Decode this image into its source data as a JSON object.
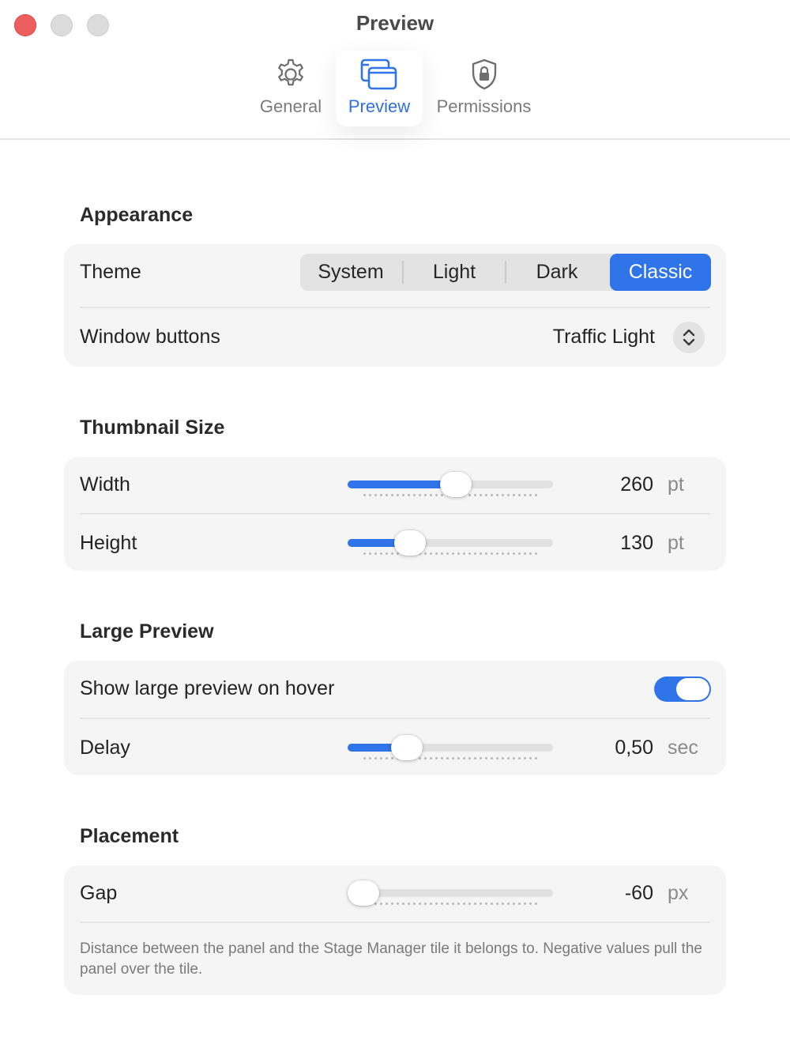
{
  "window": {
    "title": "Preview"
  },
  "tabs": [
    {
      "label": "General",
      "icon": "gear-icon",
      "selected": false
    },
    {
      "label": "Preview",
      "icon": "windows-icon",
      "selected": true
    },
    {
      "label": "Permissions",
      "icon": "shield-lock-icon",
      "selected": false
    }
  ],
  "appearance": {
    "title": "Appearance",
    "theme": {
      "label": "Theme",
      "options": [
        "System",
        "Light",
        "Dark",
        "Classic"
      ],
      "selected": "Classic"
    },
    "window_buttons": {
      "label": "Window buttons",
      "value": "Traffic Light"
    }
  },
  "thumbnail_size": {
    "title": "Thumbnail Size",
    "width": {
      "label": "Width",
      "value": "260",
      "unit": "pt",
      "fraction": 0.53
    },
    "height": {
      "label": "Height",
      "value": "130",
      "unit": "pt",
      "fraction": 0.27
    }
  },
  "large_preview": {
    "title": "Large Preview",
    "show_on_hover": {
      "label": "Show large preview on hover",
      "on": true
    },
    "delay": {
      "label": "Delay",
      "value": "0,50",
      "unit": "sec",
      "fraction": 0.25
    }
  },
  "placement": {
    "title": "Placement",
    "gap": {
      "label": "Gap",
      "value": "-60",
      "unit": "px",
      "fraction": 0.0
    },
    "description": "Distance between the panel and the Stage Manager tile it belongs to. Negative values pull the panel over the tile."
  },
  "colors": {
    "accent": "#2f74e8",
    "close": "#ed5f5c",
    "card": "#f5f5f5"
  }
}
